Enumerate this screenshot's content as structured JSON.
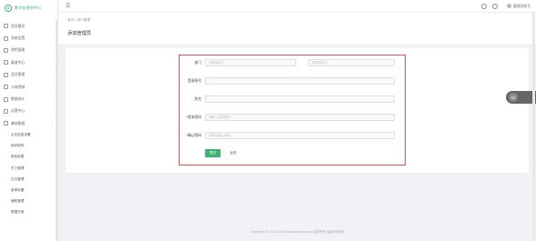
{
  "app": {
    "logo_text": "数字化营销中心"
  },
  "sidebar": {
    "items": [
      {
        "label": "首页概览",
        "icon": "home-icon"
      },
      {
        "label": "系统设置",
        "icon": "settings-icon"
      },
      {
        "label": "角色管理",
        "icon": "role-icon"
      },
      {
        "label": "渠道中心",
        "icon": "channel-icon"
      },
      {
        "label": "会员管理",
        "icon": "member-icon"
      },
      {
        "label": "卡券营销",
        "icon": "coupon-icon"
      },
      {
        "label": "数据统计",
        "icon": "chart-icon"
      },
      {
        "label": "运营中心",
        "icon": "ops-icon"
      },
      {
        "label": "基础数据",
        "icon": "data-icon"
      }
    ],
    "subitems": [
      "企业信息设置",
      "组织架构",
      "角色权限",
      "员工管理",
      "日志管理",
      "菜单设置",
      "通知管理",
      "数据字典"
    ]
  },
  "topbar": {
    "menu_toggle": "☰",
    "user_name": "管理员账号"
  },
  "page": {
    "breadcrumb": "首页  /  用户管理",
    "title": "添加管理员"
  },
  "form": {
    "department_label": "部门",
    "department_placeholder": "请选择部门",
    "department2_placeholder": "请选择岗位",
    "account_label": "登录账号",
    "account_value": "",
    "name_label": "姓名",
    "name_value": "",
    "password_label": "登录密码",
    "password_placeholder": "请输入登录密码",
    "confirm_label": "确认密码",
    "confirm_placeholder": "请再次输入密码",
    "required_mark": "*",
    "submit_label": "提交",
    "back_label": "返回"
  },
  "side_float": {
    "label": "64"
  },
  "footer": {
    "text": "Copyright © 2015-2019 www.example.com 版权所有 保留所有权利"
  },
  "colors": {
    "accent": "#3cb371",
    "highlight_border": "#d9534f",
    "required": "#e4393c"
  }
}
